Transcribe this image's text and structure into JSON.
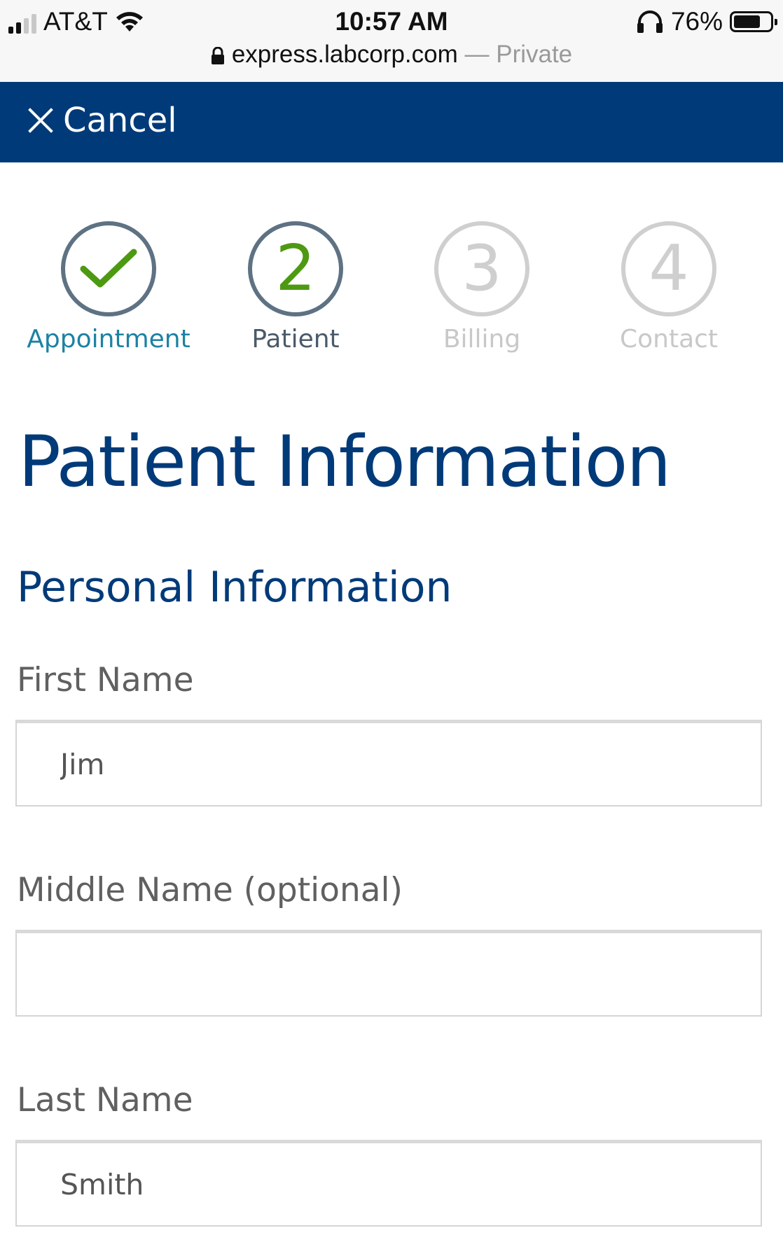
{
  "status_bar": {
    "carrier": "AT&T",
    "time": "10:57 AM",
    "battery_percent": "76%",
    "battery_level": 0.76
  },
  "browser": {
    "url": "express.labcorp.com",
    "separator": " — ",
    "mode": "Private"
  },
  "header": {
    "cancel_label": "Cancel"
  },
  "stepper": {
    "steps": [
      {
        "label": "Appointment",
        "number": "",
        "state": "complete"
      },
      {
        "label": "Patient",
        "number": "2",
        "state": "current"
      },
      {
        "label": "Billing",
        "number": "3",
        "state": "upcoming"
      },
      {
        "label": "Contact",
        "number": "4",
        "state": "upcoming"
      }
    ]
  },
  "page": {
    "title": "Patient Information",
    "section_title": "Personal Information"
  },
  "form": {
    "first_name": {
      "label": "First Name",
      "value": "Jim"
    },
    "middle_name": {
      "label": "Middle Name (optional)",
      "value": ""
    },
    "last_name": {
      "label": "Last Name",
      "value": "Smith"
    }
  },
  "colors": {
    "brand_navy": "#003a79",
    "step_done_teal": "#1c82a3",
    "check_green": "#4d9a12",
    "inactive_gray": "#cfcfcf"
  }
}
